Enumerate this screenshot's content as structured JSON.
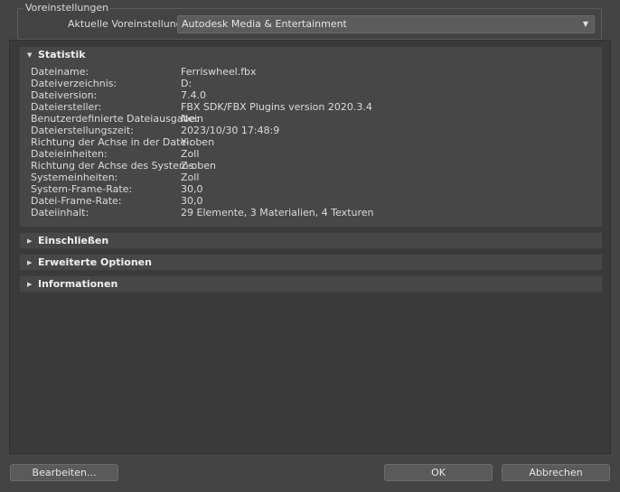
{
  "presets": {
    "group_title": "Voreinstellungen",
    "current_label": "Aktuelle Voreinstellung:",
    "current_value": "Autodesk Media & Entertainment"
  },
  "sections": {
    "statistics": {
      "title": "Statistik",
      "rows": [
        {
          "key": "Dateiname:",
          "value": "Ferriswheel.fbx"
        },
        {
          "key": "Dateiverzeichnis:",
          "value": "D:"
        },
        {
          "key": "Dateiversion:",
          "value": "7.4.0"
        },
        {
          "key": "Dateiersteller:",
          "value": "FBX SDK/FBX Plugins version 2020.3.4"
        },
        {
          "key": "Benutzerdefinierte Dateiausgabe:",
          "value": "Nein"
        },
        {
          "key": "Dateierstellungszeit:",
          "value": "2023/10/30  17:48:9"
        },
        {
          "key": "Richtung der Achse in der Datei:",
          "value": "Y-oben"
        },
        {
          "key": "Dateieinheiten:",
          "value": "Zoll"
        },
        {
          "key": "Richtung der Achse des Systems:",
          "value": "Z-oben"
        },
        {
          "key": "Systemeinheiten:",
          "value": "Zoll"
        },
        {
          "key": "System-Frame-Rate:",
          "value": "30,0"
        },
        {
          "key": "Datei-Frame-Rate:",
          "value": "30,0"
        },
        {
          "key": "Dateiinhalt:",
          "value": "29 Elemente,   3 Materialien,   4 Texturen"
        }
      ]
    },
    "include": {
      "title": "Einschließen"
    },
    "advanced": {
      "title": "Erweiterte Optionen"
    },
    "information": {
      "title": "Informationen"
    }
  },
  "buttons": {
    "edit": "Bearbeiten...",
    "ok": "OK",
    "cancel": "Abbrechen"
  },
  "icons": {
    "expanded": "triangle-down",
    "collapsed": "triangle-right",
    "dropdown": "triangle-down"
  }
}
